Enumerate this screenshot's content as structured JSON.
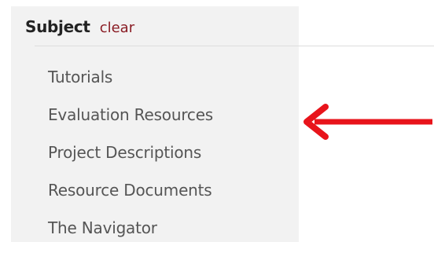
{
  "facet": {
    "title": "Subject",
    "clear_label": "clear",
    "items": [
      {
        "label": "Tutorials"
      },
      {
        "label": "Evaluation Resources"
      },
      {
        "label": "Project Descriptions"
      },
      {
        "label": "Resource Documents"
      },
      {
        "label": "The Navigator"
      }
    ]
  },
  "annotation": {
    "arrow_color": "#e8141b",
    "arrow_icon": "arrow-left-icon"
  },
  "colors": {
    "panel_bg": "#f2f2f2",
    "link": "#8a1c24",
    "item_text": "#555555"
  }
}
